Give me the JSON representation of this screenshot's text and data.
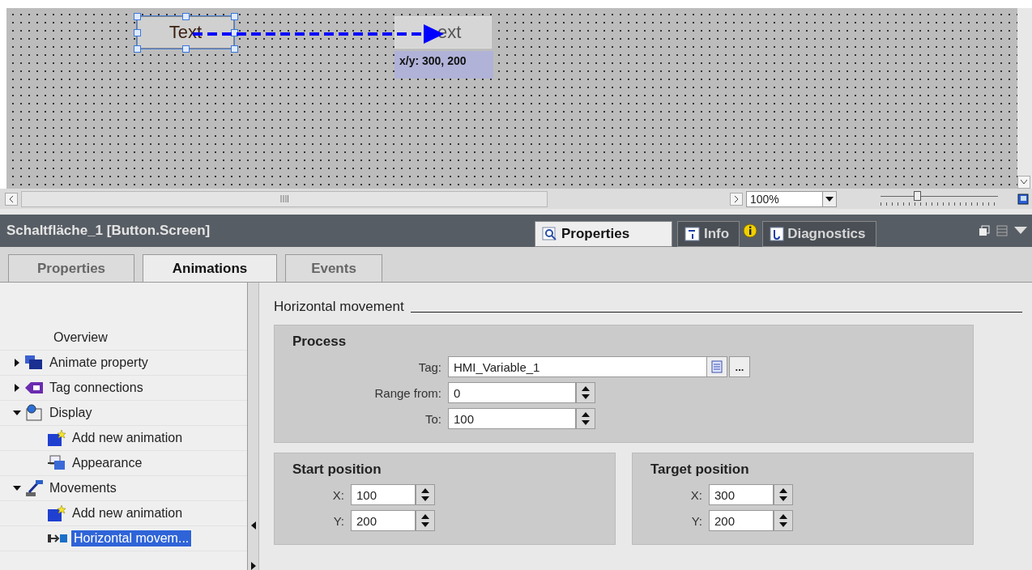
{
  "canvas": {
    "objects": [
      {
        "kind": "button",
        "label": "Text",
        "selected": true
      },
      {
        "kind": "ghost",
        "label": "ext",
        "selected": false
      }
    ],
    "position_tooltip": "x/y: 300, 200"
  },
  "zoom": {
    "value": "100%",
    "level": 0.3
  },
  "inspector": {
    "title": "Schaltfläche_1 [Button.Screen]",
    "tabs": [
      {
        "label": "Properties",
        "kind": "properties",
        "selected": true
      },
      {
        "label": "Info",
        "kind": "info",
        "selected": false
      },
      {
        "label": "Diagnostics",
        "kind": "diagnostics",
        "selected": false
      }
    ]
  },
  "subtabs": [
    {
      "label": "Properties",
      "selected": false
    },
    {
      "label": "Animations",
      "selected": true
    },
    {
      "label": "Events",
      "selected": false
    }
  ],
  "tree": [
    {
      "label": "Overview",
      "kind": "overview",
      "selected": false
    },
    {
      "label": "Animate property",
      "kind": "property",
      "expanded": false,
      "selected": false
    },
    {
      "label": "Tag connections",
      "kind": "tag",
      "expanded": false,
      "selected": false
    },
    {
      "label": "Display",
      "kind": "display",
      "expanded": true,
      "selected": false,
      "children": [
        {
          "label": "Add new animation",
          "kind": "add",
          "selected": false
        },
        {
          "label": "Appearance",
          "kind": "appearance",
          "selected": false
        }
      ]
    },
    {
      "label": "Movements",
      "kind": "movements",
      "expanded": true,
      "selected": false,
      "children": [
        {
          "label": "Add new animation",
          "kind": "add",
          "selected": false
        },
        {
          "label": "Horizontal movem...",
          "kind": "horizontal",
          "selected": true
        }
      ]
    }
  ],
  "section": {
    "title": "Horizontal movement",
    "process": {
      "title": "Process",
      "fields": [
        {
          "label": "Tag:",
          "value": "HMI_Variable_1",
          "kind": "tag",
          "button_label": "..."
        },
        {
          "label": "Range from:",
          "value": "0",
          "kind": "spin"
        },
        {
          "label": "To:",
          "value": "100",
          "kind": "spin"
        }
      ]
    },
    "positions": [
      {
        "title": "Start position",
        "fields": [
          {
            "label": "X:",
            "value": "100"
          },
          {
            "label": "Y:",
            "value": "200"
          }
        ]
      },
      {
        "title": "Target position",
        "fields": [
          {
            "label": "X:",
            "value": "300"
          },
          {
            "label": "Y:",
            "value": "200"
          }
        ]
      }
    ]
  }
}
